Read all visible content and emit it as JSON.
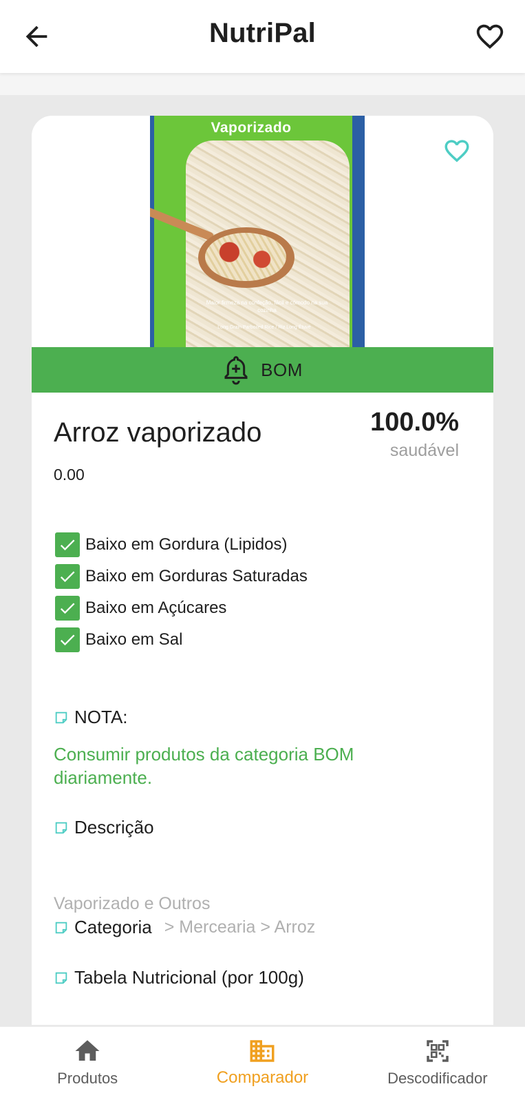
{
  "app": {
    "title": "NutriPal"
  },
  "product": {
    "package_brand_text": "Vaporizado",
    "package_caption": "Maior firmeza na confeção, fácil e cómodo na sua cozinha",
    "package_caption2": "Long Grain Parboiled Rice / Riz Long Étuvé",
    "rating": "BOM",
    "name": "Arroz vaporizado",
    "score": "100.0%",
    "score_label": "saudável",
    "price": "0.00",
    "features": [
      "Baixo em Gordura (Lipidos)",
      "Baixo em Gorduras Saturadas",
      "Baixo em Açúcares",
      "Baixo em Sal"
    ],
    "note_title": "NOTA:",
    "note_text": "Consumir produtos da categoria BOM diariamente.",
    "description_title": "Descrição",
    "description_value": "Vaporizado e Outros",
    "category_title": "Categoria",
    "category_path": "> Mercearia > Arroz",
    "nutrition_title": "Tabela Nutricional (por 100g)"
  },
  "bottom_nav": {
    "items": [
      {
        "label": "Produtos",
        "icon": "home-icon"
      },
      {
        "label": "Comparador",
        "icon": "building-icon",
        "active": true
      },
      {
        "label": "Descodificador",
        "icon": "qr-scan-icon"
      }
    ]
  },
  "colors": {
    "accent_green": "#4caf50",
    "active_orange": "#f0a020",
    "teal_heart": "#4ecdc4"
  }
}
